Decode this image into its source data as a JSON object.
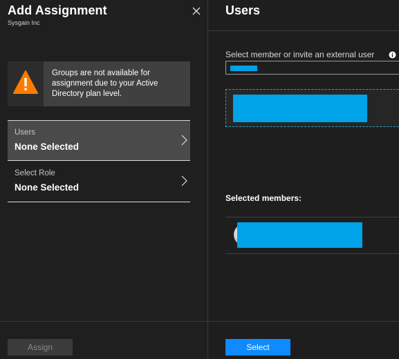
{
  "left_blade": {
    "title": "Add Assignment",
    "subtitle": "Sysgain Inc",
    "close_icon": "close-icon",
    "warning": {
      "icon": "warning-icon",
      "icon_color": "#ff7a00",
      "text": "Groups are not available for assignment due to your Active Directory plan level."
    },
    "nav_items": [
      {
        "label": "Users",
        "value": "None Selected",
        "icon": "chevron-right-icon"
      },
      {
        "label": "Select Role",
        "value": "None Selected",
        "icon": "chevron-right-icon"
      }
    ],
    "assign_label": "Assign"
  },
  "right_blade": {
    "title": "Users",
    "search": {
      "label": "Select member or invite an external user",
      "info_icon": "info-icon",
      "value": ""
    },
    "selected_members_label": "Selected members:",
    "select_label": "Select"
  },
  "colors": {
    "background": "#1e1e1e",
    "selected_nav": "#4a4a4a",
    "primary_button": "#0f8aff",
    "redaction": "#00a2e8",
    "warning_orange": "#ff7a00"
  }
}
